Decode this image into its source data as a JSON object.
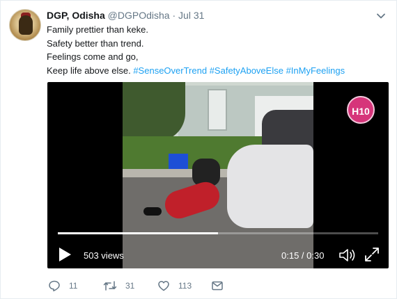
{
  "tweet": {
    "author": {
      "name": "DGP, Odisha",
      "handle": "@DGPOdisha",
      "separator": "·",
      "date": "Jul 31"
    },
    "lines": [
      "Family prettier than keke.",
      "Safety better than trend.",
      "Feelings come and go,"
    ],
    "last_line_text": "Keep life above else.",
    "hashtags": [
      "#SenseOverTrend",
      "#SafetyAboveElse",
      "#InMyFeelings"
    ]
  },
  "video": {
    "badge": "H10",
    "views": "503 views",
    "time": "0:15 / 0:30",
    "progress": 0.5
  },
  "actions": {
    "replies": "11",
    "retweets": "31",
    "likes": "113"
  },
  "colors": {
    "link": "#1da1f2",
    "muted": "#657786",
    "text": "#14171a"
  }
}
